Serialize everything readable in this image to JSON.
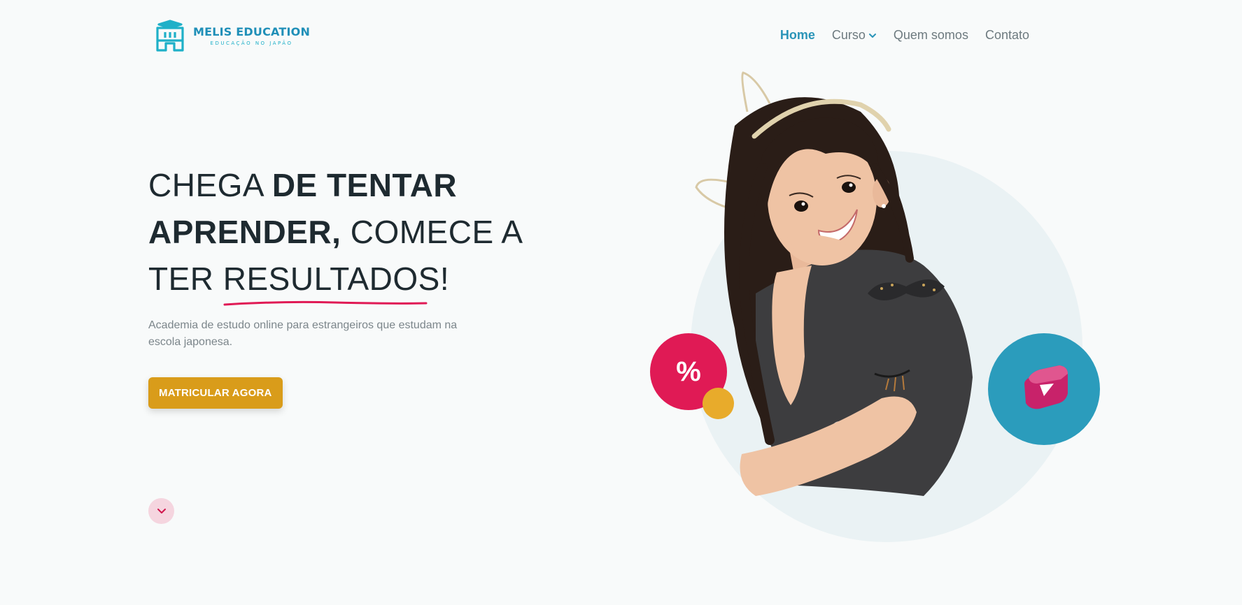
{
  "brand": {
    "name": "MELIS EDUCATION",
    "tagline": "EDUCAÇÃO NO JAPÃO",
    "logo_icon": "building-graduation-cap-icon",
    "color": "#1f8fb8"
  },
  "nav": {
    "items": [
      {
        "label": "Home",
        "active": true
      },
      {
        "label": "Curso",
        "active": false,
        "has_dropdown": true
      },
      {
        "label": "Quem somos",
        "active": false
      },
      {
        "label": "Contato",
        "active": false
      }
    ]
  },
  "hero": {
    "headline": {
      "part1": "CHEGA ",
      "part2": "DE TENTAR APRENDER,",
      "part3": " COMECE A TER ",
      "part4": "RESULTADOS",
      "part5": "!"
    },
    "subtitle": "Academia de estudo online para estrangeiros que estudam na escola japonesa.",
    "cta_label": "MATRICULAR AGORA",
    "accent_color": "#e01a55",
    "cta_color": "#d99c1a"
  },
  "badges": {
    "percent_symbol": "%",
    "play_icon": "play-cube-icon"
  }
}
